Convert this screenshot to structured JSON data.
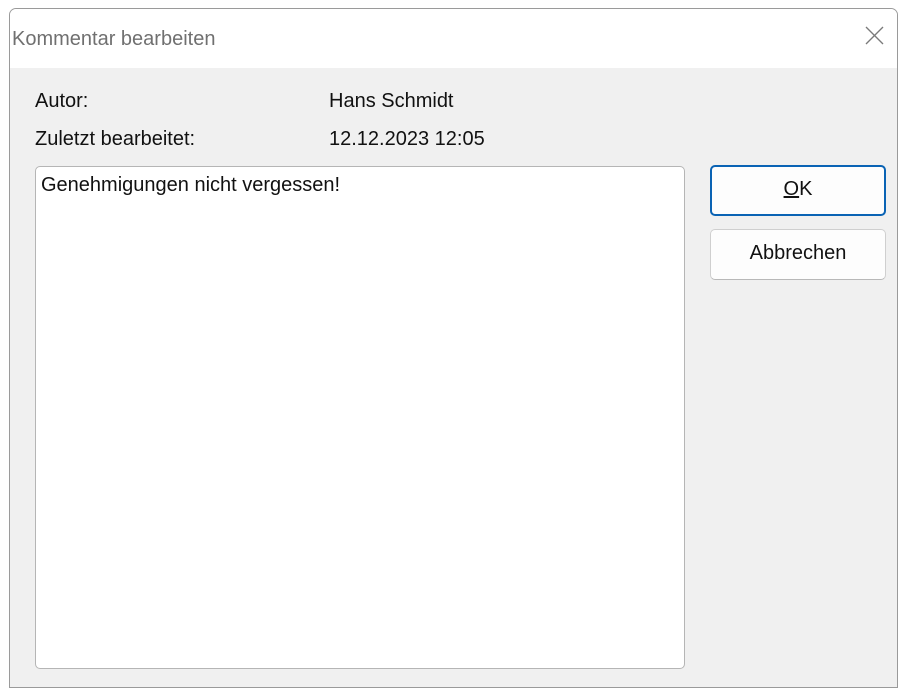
{
  "window": {
    "title": "Kommentar bearbeiten",
    "close_icon": "close-icon"
  },
  "info": {
    "author_label": "Autor:",
    "author_value": "Hans Schmidt",
    "edited_label": "Zuletzt bearbeitet:",
    "edited_value": "12.12.2023 12:05"
  },
  "comment": {
    "text": "Genehmigungen nicht vergessen!"
  },
  "buttons": {
    "ok_mnemonic": "O",
    "ok_rest": "K",
    "cancel_label": "Abbrechen"
  },
  "colors": {
    "dialog_background": "#f0f0f0",
    "default_button_border": "#0a63b4"
  }
}
